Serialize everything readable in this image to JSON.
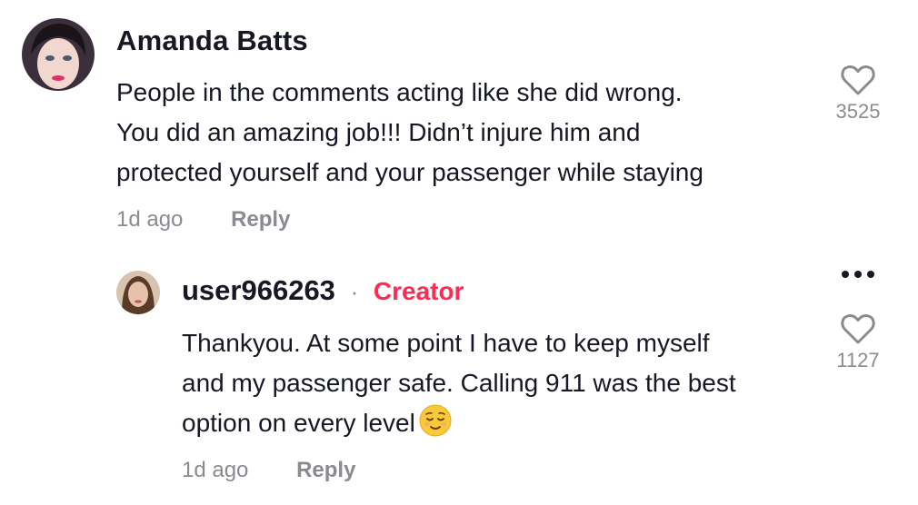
{
  "comment": {
    "avatar_icon": "avatar-amanda-batts",
    "username": "Amanda Batts",
    "text_lines": [
      "People in the comments acting like she did wrong.",
      "You did an amazing job!!! Didn’t injure him and",
      "protected yourself and your passenger while staying"
    ],
    "time": "1d ago",
    "reply_label": "Reply",
    "likes": "3525"
  },
  "reply": {
    "avatar_icon": "avatar-user966263",
    "username": "user966263",
    "separator": "·",
    "badge": "Creator",
    "text_lines": [
      "Thankyou. At some point I have to keep myself",
      "and my passenger safe. Calling 911 was the best",
      "option on every level"
    ],
    "emoji": "relieved-face-emoji",
    "time": "1d ago",
    "reply_label": "Reply",
    "likes": "1127",
    "more_icon": "more-dots-icon"
  },
  "colors": {
    "text": "#161823",
    "muted": "#8a8b91",
    "creator": "#fe2c55"
  }
}
